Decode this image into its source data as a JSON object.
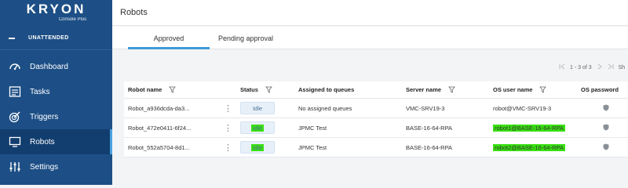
{
  "brand": {
    "name": "KRYON",
    "subtitle": "Console Plus"
  },
  "sidebar": {
    "mode_label": "UNATTENDED",
    "items": [
      {
        "label": "Dashboard",
        "icon": "dashboard-icon",
        "active": false
      },
      {
        "label": "Tasks",
        "icon": "tasks-icon",
        "active": false
      },
      {
        "label": "Triggers",
        "icon": "triggers-icon",
        "active": false
      },
      {
        "label": "Robots",
        "icon": "robots-icon",
        "active": true
      },
      {
        "label": "Settings",
        "icon": "settings-icon",
        "active": false
      }
    ]
  },
  "header": {
    "title": "Robots"
  },
  "tabs": [
    {
      "label": "Approved",
      "active": true
    },
    {
      "label": "Pending approval",
      "active": false
    }
  ],
  "pager": {
    "range": "1 - 3 of 3",
    "partial_label": "Sh"
  },
  "table": {
    "columns": [
      "Robot name",
      "Status",
      "Assigned to queues",
      "Server name",
      "OS user name",
      "OS password"
    ],
    "rows": [
      {
        "name": "Robot_a936dcda-da3...",
        "status": "Idle",
        "queues": "No assigned queues",
        "server": "VMC-SRV19-3",
        "os_user": "robot@VMC-SRV19-3"
      },
      {
        "name": "Robot_472e0411-6f24...",
        "status": "Idle",
        "queues": "JPMC Test",
        "server": "BASE-16-64-RPA",
        "os_user": "robot1@BASE-16-64-RPA"
      },
      {
        "name": "Robot_552a5704-8d1...",
        "status": "Idle",
        "queues": "JPMC Test",
        "server": "BASE-16-64-RPA",
        "os_user": "robot2@BASE-16-64-RPA"
      }
    ]
  },
  "colors": {
    "sidebar": "#1d4f86",
    "sidebar_active": "#123e6f",
    "accent": "#3f9ad8",
    "highlight": "#39e012"
  }
}
